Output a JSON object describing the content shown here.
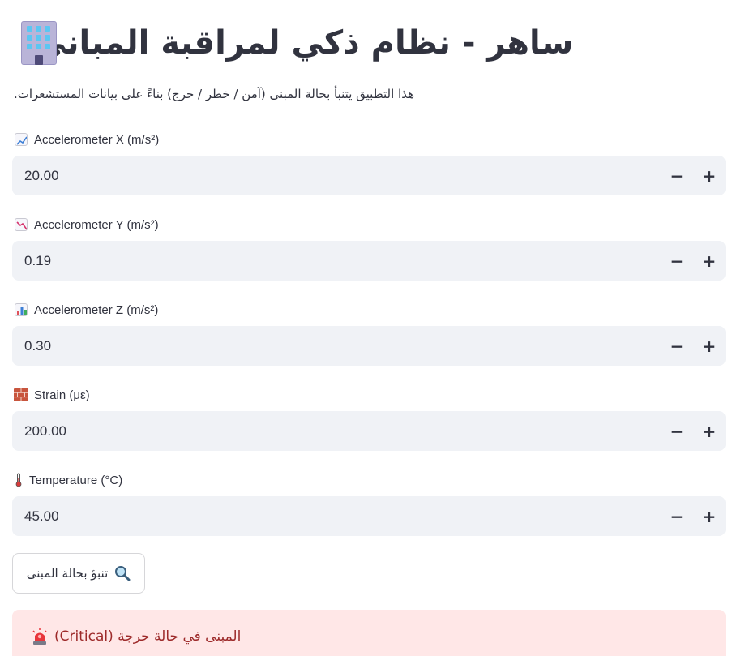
{
  "header": {
    "title": "ساهر - نظام ذكي لمراقبة المباني",
    "icon": "office-building-icon"
  },
  "subtitle": "هذا التطبيق يتنبأ بحالة المبنى (آمن / خطر / حرج) بناءً على بيانات المستشعرات.",
  "fields": [
    {
      "label": "Accelerometer X (m/s²)",
      "value": "20.00",
      "icon": "chart-increasing-icon"
    },
    {
      "label": "Accelerometer Y (m/s²)",
      "value": "0.19",
      "icon": "chart-decreasing-icon"
    },
    {
      "label": "Accelerometer Z (m/s²)",
      "value": "0.30",
      "icon": "bar-chart-icon"
    },
    {
      "label": "Strain (με)",
      "value": "200.00",
      "icon": "brick-icon"
    },
    {
      "label": "Temperature (°C)",
      "value": "45.00",
      "icon": "thermometer-icon"
    }
  ],
  "stepper": {
    "minus": "−",
    "plus": "+"
  },
  "predict_button": {
    "label": "تنبؤ بحالة المبنى",
    "icon": "magnifying-glass-icon"
  },
  "alert": {
    "text": "المبنى في حالة حرجة (Critical)",
    "icon": "police-light-icon",
    "color": "#9d2a2a",
    "background": "#ffe7e7"
  }
}
